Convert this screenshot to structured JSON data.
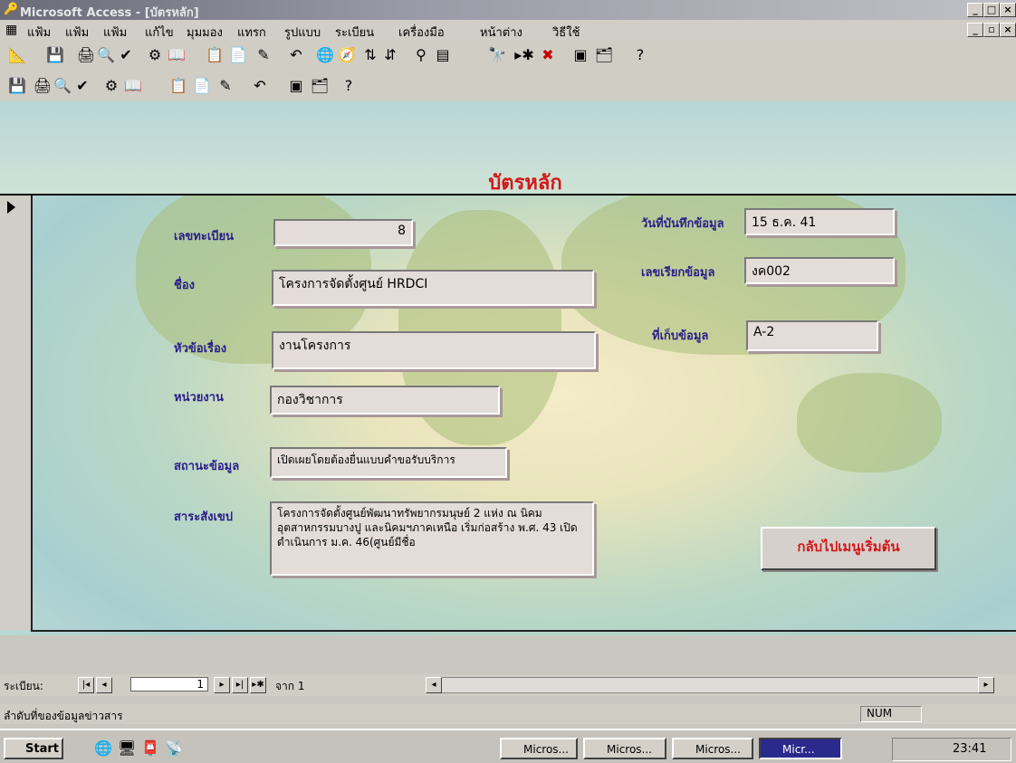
{
  "window": {
    "title": "Microsoft Access - [บัตรหลัก]",
    "min": "_",
    "max": "□",
    "close": "×",
    "restore": "▫"
  },
  "menu": [
    "แฟ้ม",
    "แฟ้ม",
    "แฟ้ม",
    "แก้ไข",
    "มุมมอง",
    "แทรก",
    "รูปแบบ",
    "ระเบียน",
    "เครื่องมือ",
    "หน้าต่าง",
    "วิธีใช้"
  ],
  "toolbar1_icons": [
    "design-icon",
    "save-icon",
    "print-icon",
    "print-preview-icon",
    "spell-check-icon",
    "office-links-icon",
    "analyze-icon",
    "cut-icon",
    "copy-icon",
    "paste-icon",
    "format-painter-icon",
    "undo-icon",
    "hyperlink-icon",
    "web-toolbar-icon",
    "sort-ascending-icon",
    "sort-descending-icon",
    "filter-by-selection-icon",
    "filter-by-form-icon",
    "find-icon",
    "new-record-icon",
    "delete-record-icon",
    "database-window-icon",
    "new-object-icon",
    "help-icon"
  ],
  "form": {
    "title": "บัตรหลัก",
    "fields": {
      "record_no_label": "เลขทะเบียน",
      "record_no": "8",
      "title_label": "ชื่อง",
      "title_value": "โครงการจัดตั้งศูนย์ HRDCI",
      "subject_label": "หัวข้อเรื่อง",
      "subject_value": "งานโครงการ",
      "unit_label": "หน่วยงาน",
      "unit_value": "กองวิชาการ",
      "status_label": "สถานะข้อมูล",
      "status_value": "เปิดเผยโดยต้องยื่นแบบคำขอรับบริการ",
      "summary_label": "สาระสังเขป",
      "summary_value": "โครงการจัดตั้งศูนย์พัฒนาทรัพยากรมนุษย์ 2 แห่ง ณ นิคมอุตสาหกรรมบางปู และนิคมฯภาคเหนือ เริ่มก่อสร้าง พ.ศ. 43 เปิดดำเนินการ ม.ค. 46(ศูนย์มีชื่อ",
      "date_label": "วันที่บันทึกข้อมูล",
      "date_value": "15 ธ.ค. 41",
      "code_label": "เลขเรียกข้อมูล",
      "code_value": "งค002",
      "storage_label": "ที่เก็บข้อมูล",
      "storage_value": "A-2"
    },
    "back_button": "กลับไปเมนูเริ่มต้น"
  },
  "navigation": {
    "label": "ระเบียน:",
    "current": "1",
    "of_label": "จาก 1"
  },
  "status": {
    "text": "ลำดับที่ของข้อมูลข่าวสาร",
    "num": "NUM"
  },
  "taskbar": {
    "start": "Start",
    "buttons": [
      "Micros...",
      "Micros...",
      "Micros...",
      "Micr..."
    ],
    "clock": "23:41"
  }
}
